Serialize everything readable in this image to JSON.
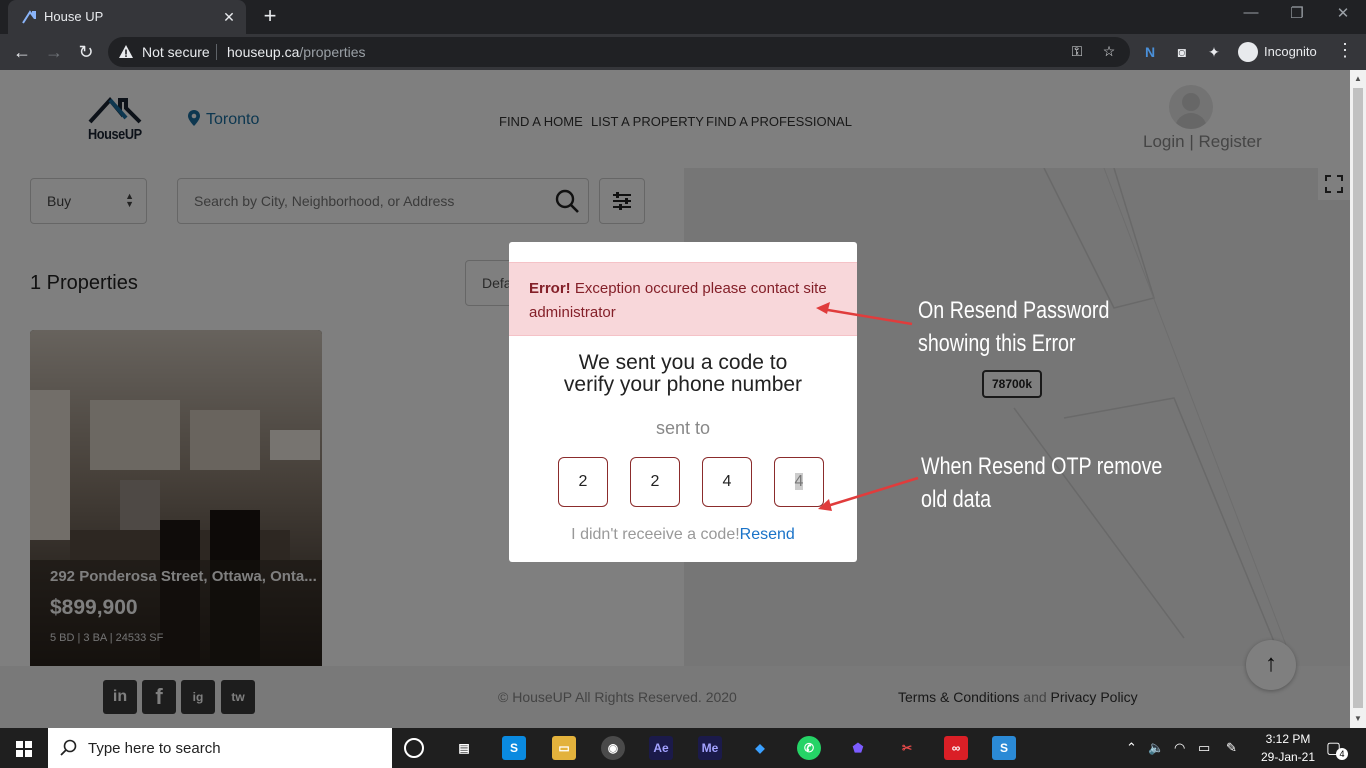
{
  "browser": {
    "tab_title": "House UP",
    "not_secure": "Not secure",
    "url_domain": "houseup.ca",
    "url_path": "/properties",
    "incognito_label": "Incognito"
  },
  "header": {
    "logo_text": "HouseUP",
    "location": "Toronto",
    "nav": [
      "FIND A HOME",
      "LIST A PROPERTY",
      "FIND A PROFESSIONAL"
    ],
    "login_label": "Login | Register"
  },
  "search": {
    "type_value": "Buy",
    "placeholder": "Search by City, Neighborhood, or Address"
  },
  "results": {
    "count_label": "1 Properties",
    "sort_value": "Default"
  },
  "listing": {
    "address": "292 Ponderosa Street, Ottawa, Onta...",
    "price": "$899,900",
    "meta": "5 BD  |  3 BA  |  24533 SF"
  },
  "map": {
    "marker_label": "78700k"
  },
  "footer": {
    "copyright": "© HouseUP All Rights Reserved. 2020",
    "terms": "Terms & Conditions",
    "and": "and",
    "privacy": "Privacy Policy",
    "social": [
      "in",
      "f",
      "ig",
      "tw"
    ]
  },
  "modal": {
    "alert_strong": "Error!",
    "alert_text": "Exception occured please contact site administrator",
    "title_line1": "We sent you a code to",
    "title_line2": "verify your phone number",
    "sent_to": "sent to",
    "otp_digits": [
      "2",
      "2",
      "4",
      "4"
    ],
    "resend_prefix": "I didn't receeive a code!",
    "resend_link": "Resend"
  },
  "annotations": {
    "top_line1": "On Resend Password",
    "top_line2": "showing this Error",
    "bottom_line1": "When Resend OTP remove",
    "bottom_line2": "old data"
  },
  "taskbar": {
    "search_placeholder": "Type here to search",
    "time": "3:12 PM",
    "date": "29-Jan-21",
    "notification_count": "4"
  },
  "colors": {
    "accent_blue": "#1a6fa1",
    "alert_bg": "#f8d7da",
    "alert_text": "#842029",
    "arrow_red": "#e03c3c"
  }
}
